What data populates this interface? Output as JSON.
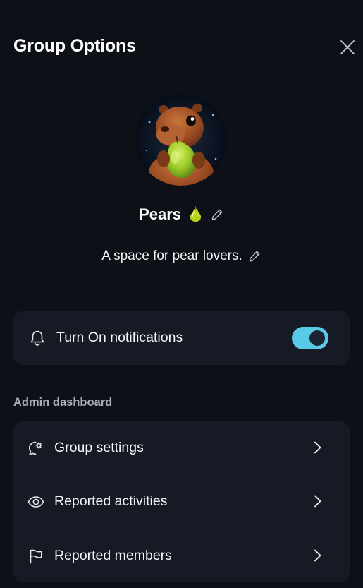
{
  "header": {
    "title": "Group Options"
  },
  "group": {
    "name": "Pears",
    "emoji": "🍐",
    "description": "A space for pear lovers."
  },
  "notifications": {
    "label": "Turn On notifications",
    "enabled": true
  },
  "admin": {
    "section_label": "Admin dashboard",
    "items": [
      {
        "label": "Group settings",
        "icon": "chat-gear-icon"
      },
      {
        "label": "Reported activities",
        "icon": "eye-icon"
      },
      {
        "label": "Reported members",
        "icon": "flag-icon"
      }
    ]
  },
  "colors": {
    "background": "#0d1017",
    "card": "#161a24",
    "toggle_on": "#58c9e6",
    "section_label": "#a8adb8"
  }
}
